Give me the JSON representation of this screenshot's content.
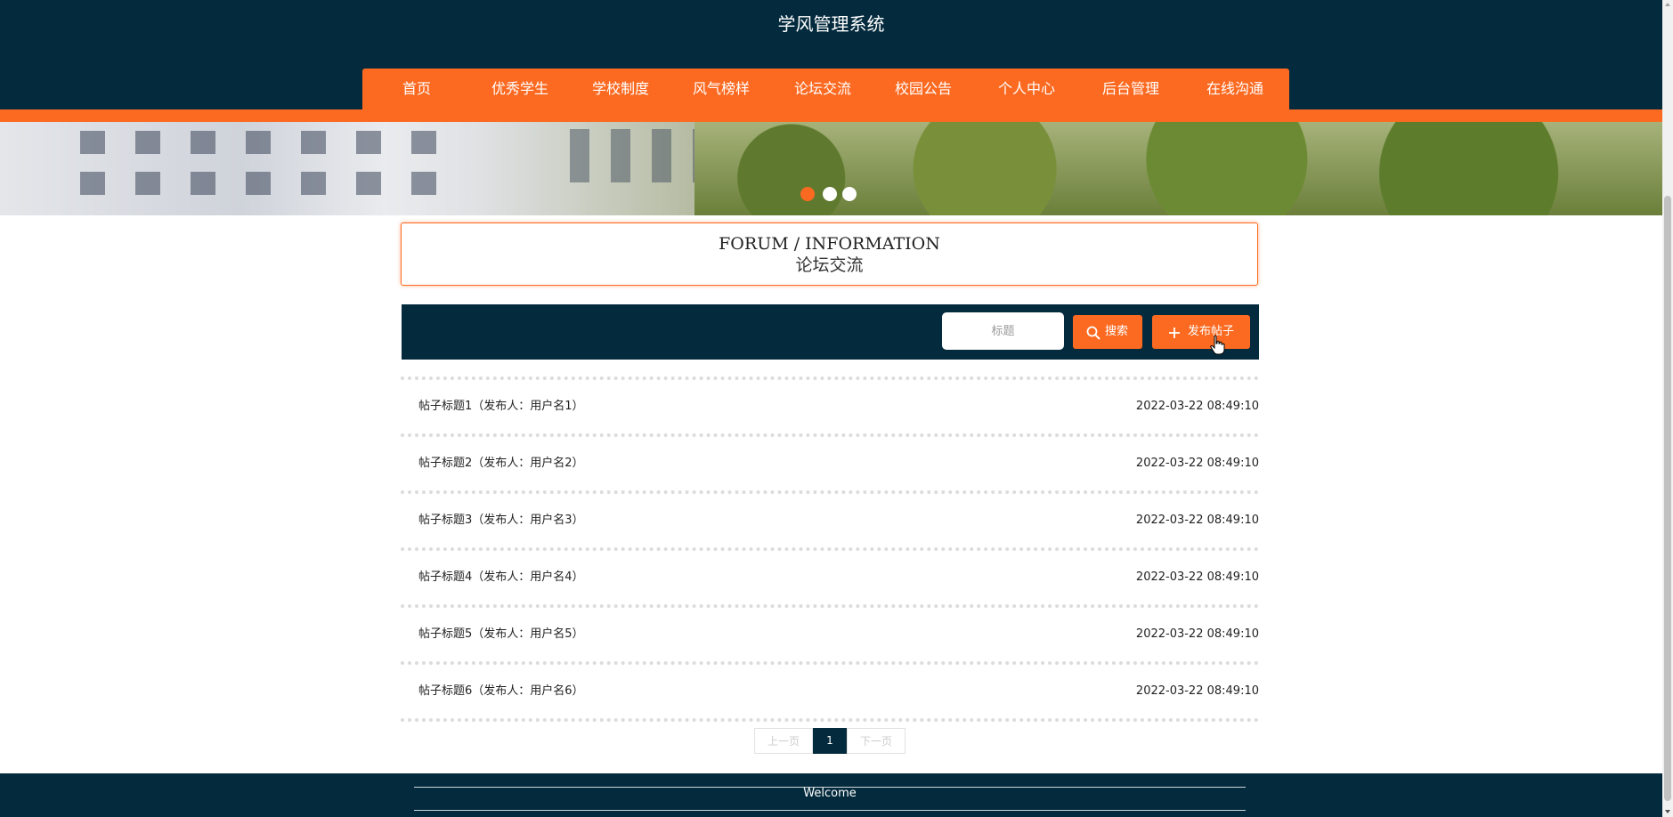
{
  "header": {
    "site_title": "学风管理系统",
    "nav": [
      "首页",
      "优秀学生",
      "学校制度",
      "风气榜样",
      "论坛交流",
      "校园公告",
      "个人中心",
      "后台管理",
      "在线沟通"
    ]
  },
  "banner": {
    "slide_count": 3,
    "active_slide": 1
  },
  "section": {
    "title_en": "FORUM / INFORMATION",
    "title_cn": "论坛交流"
  },
  "toolbar": {
    "search_placeholder": "标题",
    "search_icon": "search-icon",
    "search_label": "搜索",
    "post_icon": "plus-icon",
    "post_label": "发布帖子"
  },
  "posts": [
    {
      "title": "帖子标题1（发布人：用户名1）",
      "time": "2022-03-22 08:49:10"
    },
    {
      "title": "帖子标题2（发布人：用户名2）",
      "time": "2022-03-22 08:49:10"
    },
    {
      "title": "帖子标题3（发布人：用户名3）",
      "time": "2022-03-22 08:49:10"
    },
    {
      "title": "帖子标题4（发布人：用户名4）",
      "time": "2022-03-22 08:49:10"
    },
    {
      "title": "帖子标题5（发布人：用户名5）",
      "time": "2022-03-22 08:49:10"
    },
    {
      "title": "帖子标题6（发布人：用户名6）",
      "time": "2022-03-22 08:49:10"
    }
  ],
  "pagination": {
    "prev": "上一页",
    "current": "1",
    "next": "下一页"
  },
  "footer": {
    "text": "Welcome"
  },
  "colors": {
    "navy": "#032a3d",
    "orange": "#fc6a21"
  }
}
